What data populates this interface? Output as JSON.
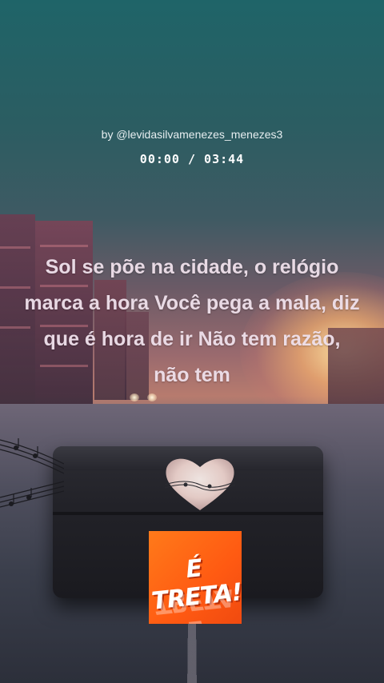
{
  "video": {
    "byline": "by @levidasilvamenezes_menezes3",
    "time_current": "00:00",
    "time_separator": "/",
    "time_total": "03:44",
    "time_display": "00:00 / 03:44",
    "progress": 0
  },
  "lyrics": {
    "text": "Sol se põe na cidade, o relógio marca a hora Você pega a mala, diz que é hora de ir Não tem razão, não tem"
  },
  "logo": {
    "label": "É TRETA!",
    "colors": {
      "background": "#ff6a14",
      "text": "#ffffff"
    }
  },
  "scene": {
    "icons": [
      "music-notes-icon",
      "heart-icon",
      "suitcase-icon"
    ],
    "colors": {
      "sky_top": "#1f6468",
      "sunset": "#f4c28a",
      "lyrics_text": "#f0e2ec"
    }
  }
}
